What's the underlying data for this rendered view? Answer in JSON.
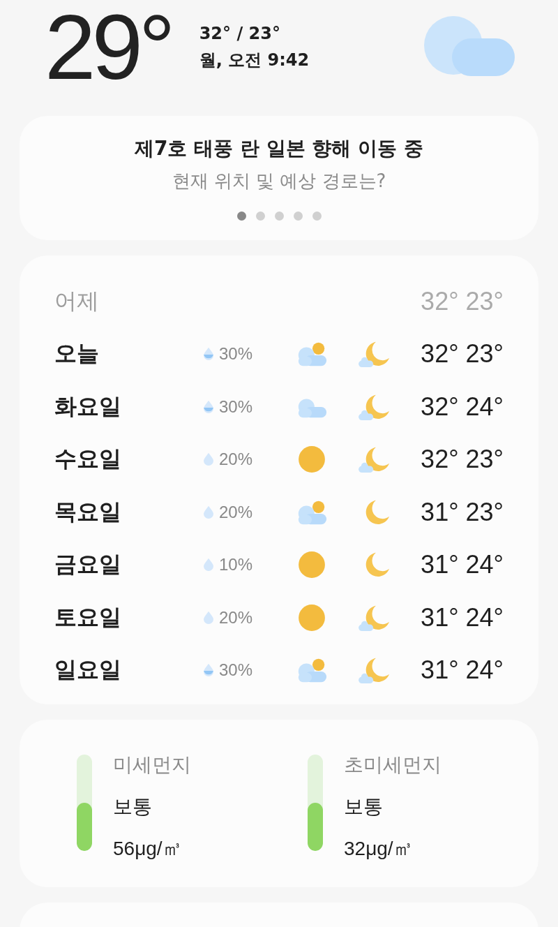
{
  "current": {
    "temperature": "29°",
    "high_low": "32° / 23°",
    "datetime": "월, 오전 9:42"
  },
  "news": {
    "title": "제7호 태풍 란 일본 향해 이동 중",
    "subtitle": "현재 위치 및 예상 경로는?",
    "pages": [
      {
        "selected": true
      },
      {
        "selected": false
      },
      {
        "selected": false
      },
      {
        "selected": false
      },
      {
        "selected": false
      }
    ]
  },
  "yesterday": {
    "label": "어제",
    "temps": "32° 23°"
  },
  "forecast": [
    {
      "day": "오늘",
      "rain_likely": true,
      "chance": "30%",
      "day_weather": {
        "kind": "partly_cloudy"
      },
      "night_weather": {
        "kind": "moon_cloud"
      },
      "temps": "32° 23°"
    },
    {
      "day": "화요일",
      "rain_likely": true,
      "chance": "30%",
      "day_weather": {
        "kind": "cloudy"
      },
      "night_weather": {
        "kind": "moon_cloud"
      },
      "temps": "32° 24°"
    },
    {
      "day": "수요일",
      "rain_likely": false,
      "chance": "20%",
      "day_weather": {
        "kind": "sunny"
      },
      "night_weather": {
        "kind": "moon_cloud"
      },
      "temps": "32° 23°"
    },
    {
      "day": "목요일",
      "rain_likely": false,
      "chance": "20%",
      "day_weather": {
        "kind": "partly_cloudy"
      },
      "night_weather": {
        "kind": "moon"
      },
      "temps": "31° 23°"
    },
    {
      "day": "금요일",
      "rain_likely": false,
      "chance": "10%",
      "day_weather": {
        "kind": "sunny"
      },
      "night_weather": {
        "kind": "moon"
      },
      "temps": "31° 24°"
    },
    {
      "day": "토요일",
      "rain_likely": false,
      "chance": "20%",
      "day_weather": {
        "kind": "sunny"
      },
      "night_weather": {
        "kind": "moon_cloud"
      },
      "temps": "31° 24°"
    },
    {
      "day": "일요일",
      "rain_likely": true,
      "chance": "30%",
      "day_weather": {
        "kind": "partly_cloudy"
      },
      "night_weather": {
        "kind": "moon_cloud"
      },
      "temps": "31° 24°"
    }
  ],
  "air_quality": [
    {
      "label": "미세먼지",
      "status": "보통",
      "value": "56μg/㎥",
      "level": 0.5,
      "color": "#8fd663"
    },
    {
      "label": "초미세먼지",
      "status": "보통",
      "value": "32μg/㎥",
      "level": 0.5,
      "color": "#8fd663"
    }
  ]
}
